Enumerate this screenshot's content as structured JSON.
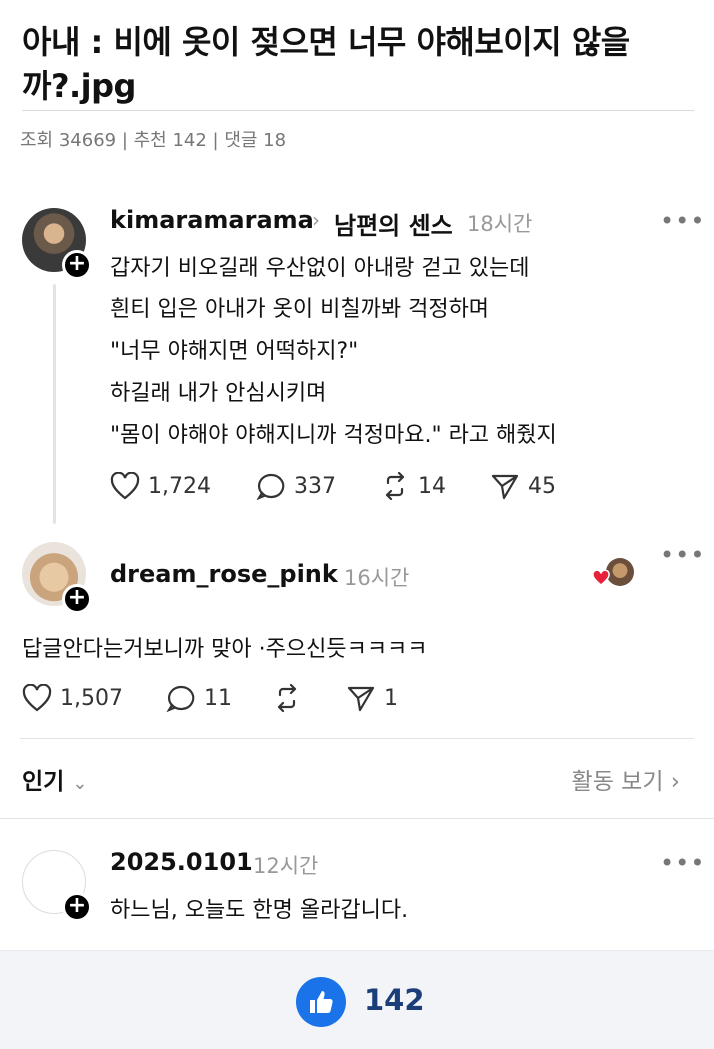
{
  "post": {
    "title": "아내 : 비에 옷이 젖으면 너무 야해보이지 않을까?.jpg",
    "meta": "조회 34669 | 추천 142 | 댓글 18"
  },
  "thread_post": {
    "username": "kimaramarama",
    "context": "남편의 센스",
    "time": "18시간",
    "lines": [
      "갑자기 비오길래 우산없이 아내랑 걷고 있는데",
      "흰티 입은 아내가 옷이 비칠까봐 걱정하며",
      "\"너무 야해지면 어떡하지?\"",
      "하길래 내가 안심시키며",
      "\"몸이 야해야 야해지니까 걱정마요.\" 라고 해줬지"
    ],
    "likes": "1,724",
    "replies": "337",
    "reposts": "14",
    "shares": "45"
  },
  "reply_post": {
    "username": "dream_rose_pink",
    "time": "16시간",
    "text": "답글안다는거보니까 맞아 ·주으신듯ㅋㅋㅋㅋ",
    "likes": "1,507",
    "replies": "11",
    "shares": "1"
  },
  "popular_bar": {
    "label": "인기",
    "activity_link": "활동 보기"
  },
  "comment": {
    "username": "2025.0101",
    "time": "12시간",
    "text": "하느님, 오늘도 한명 올라갑니다."
  },
  "recommend": {
    "count": "142"
  },
  "colors": {
    "like_button": "#1a73e8",
    "like_count": "#1c3e78",
    "heart_badge": "#e8213a"
  }
}
